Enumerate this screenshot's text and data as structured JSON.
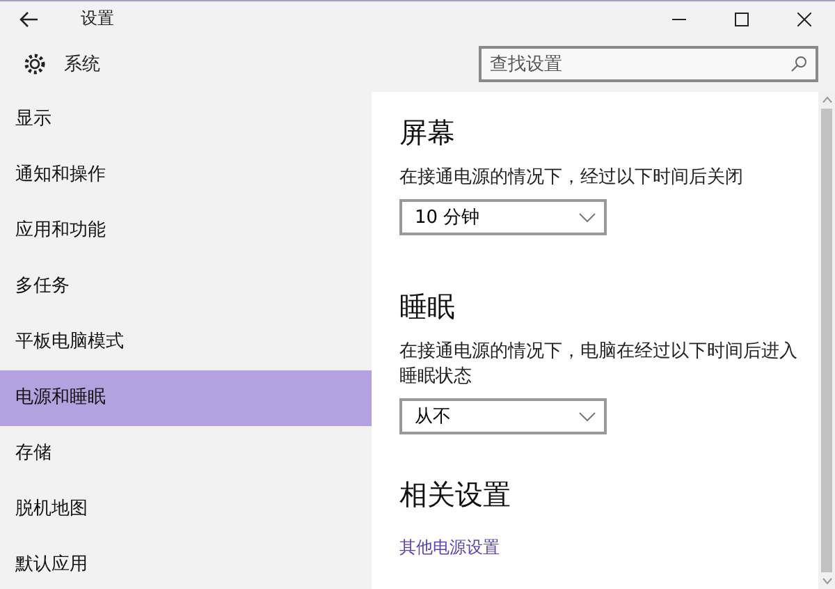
{
  "window": {
    "title": "设置"
  },
  "header": {
    "title": "系统"
  },
  "search": {
    "placeholder": "查找设置"
  },
  "sidebar": {
    "items": [
      {
        "label": "显示",
        "selected": false
      },
      {
        "label": "通知和操作",
        "selected": false
      },
      {
        "label": "应用和功能",
        "selected": false
      },
      {
        "label": "多任务",
        "selected": false
      },
      {
        "label": "平板电脑模式",
        "selected": false
      },
      {
        "label": "电源和睡眠",
        "selected": true
      },
      {
        "label": "存储",
        "selected": false
      },
      {
        "label": "脱机地图",
        "selected": false
      },
      {
        "label": "默认应用",
        "selected": false
      }
    ]
  },
  "sections": [
    {
      "kind": "dropdown",
      "heading": "屏幕",
      "description": "在接通电源的情况下，经过以下时间后关闭",
      "value": "10 分钟"
    },
    {
      "kind": "dropdown",
      "heading": "睡眠",
      "description": "在接通电源的情况下，电脑在经过以下时间后进入睡眠状态",
      "value": "从不"
    },
    {
      "kind": "links",
      "heading": "相关设置",
      "links": [
        "其他电源设置"
      ]
    }
  ]
}
